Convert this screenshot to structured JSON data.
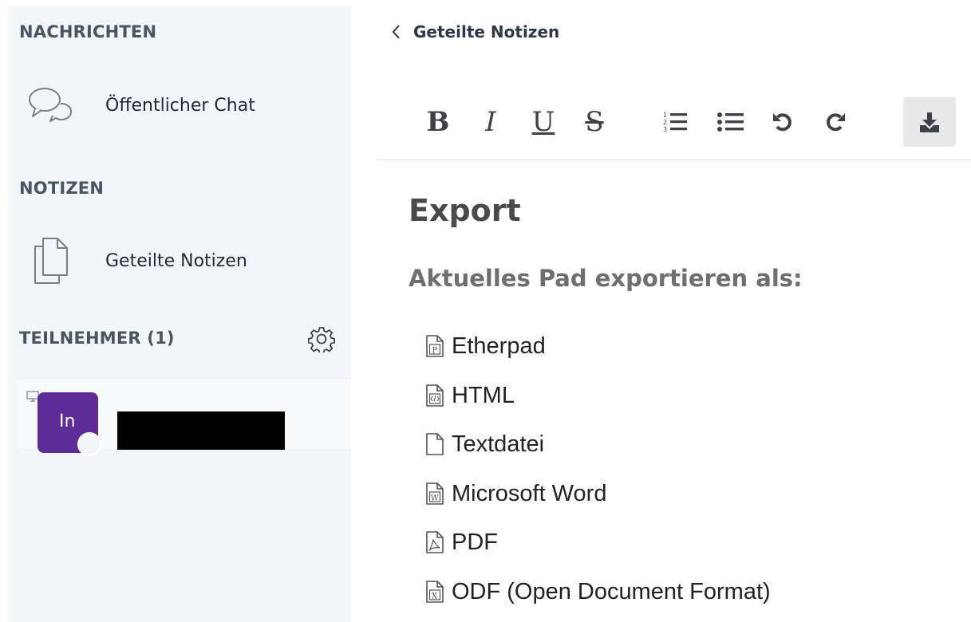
{
  "sidebar": {
    "messages_title": "NACHRICHTEN",
    "public_chat_label": "Öffentlicher Chat",
    "notes_title": "NOTIZEN",
    "shared_notes_label": "Geteilte Notizen",
    "participants_title": "TEILNEHMER (1)",
    "user_initials": "In"
  },
  "header": {
    "back_label": "Geteilte Notizen"
  },
  "toolbar": {
    "bold": "B",
    "italic": "I",
    "underline": "U",
    "strike": "S"
  },
  "content": {
    "heading": "Export",
    "subheading": "Aktuelles Pad exportieren als:",
    "formats": [
      "Etherpad",
      "HTML",
      "Textdatei",
      "Microsoft Word",
      "PDF",
      "ODF (Open Document Format)"
    ]
  },
  "colors": {
    "sidebar_bg": "#f3f6f9",
    "avatar": "#5e2b97",
    "export_button_bg": "#e8e8e8"
  }
}
